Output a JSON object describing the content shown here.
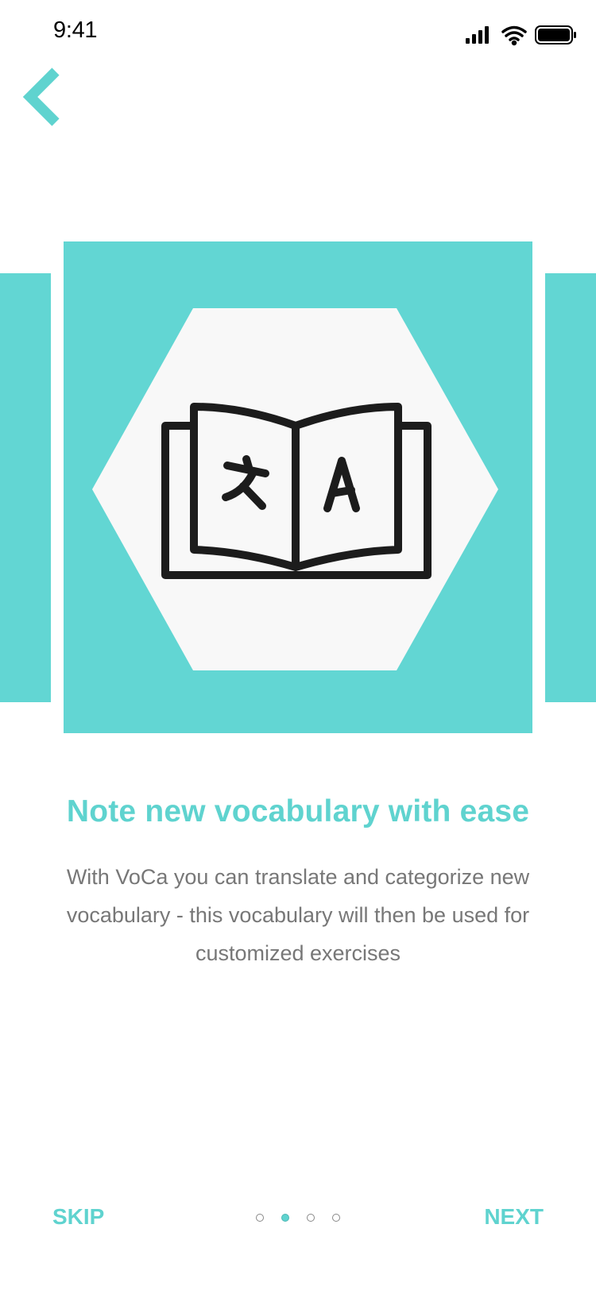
{
  "status_bar": {
    "time": "9:41",
    "icons": [
      "signal-icon",
      "wifi-icon",
      "battery-icon"
    ]
  },
  "nav": {
    "back_icon": "chevron-left-icon"
  },
  "carousel": {
    "illustration_icon": "translate-book-icon",
    "card_color": "#62d6d3",
    "hexagon_color": "#f8f8f8"
  },
  "content": {
    "title": "Note new vocabulary with ease",
    "description": "With VoCa you can translate and categorize new vocabulary - this vocabulary will then be used for customized exercises"
  },
  "footer": {
    "skip_label": "SKIP",
    "next_label": "NEXT",
    "page_count": 4,
    "active_page": 2
  },
  "colors": {
    "accent": "#5fd3cf",
    "text_muted": "#777777"
  }
}
